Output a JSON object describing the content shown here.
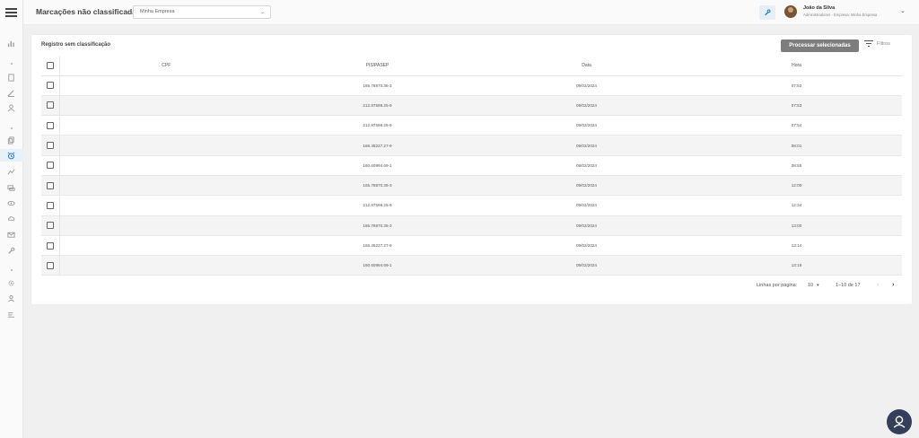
{
  "header": {
    "page_title": "Marcações não classificadas",
    "company_select": {
      "value": "Minha Empresa"
    },
    "user": {
      "name": "João da Silva",
      "role": "Administradores - Empresa: Minha Empresa"
    }
  },
  "sidebar": {
    "items": [
      {
        "icon": "menu-icon"
      },
      {
        "icon": "chart-icon"
      },
      {
        "icon": "document-icon"
      },
      {
        "icon": "pen-icon"
      },
      {
        "icon": "user-icon"
      },
      {
        "icon": "copy-icon"
      },
      {
        "icon": "alarm-clock-icon",
        "active": true
      },
      {
        "icon": "trend-icon"
      },
      {
        "icon": "chat-icon"
      },
      {
        "icon": "eye-icon"
      },
      {
        "icon": "cloud-icon"
      },
      {
        "icon": "mail-icon"
      },
      {
        "icon": "wrench-icon"
      },
      {
        "icon": "settings-icon"
      },
      {
        "icon": "person-icon"
      },
      {
        "icon": "list-icon"
      }
    ]
  },
  "card": {
    "title": "Registro sem classificação",
    "process_button": "Processar selecionadas",
    "filters_label": "Filtros"
  },
  "table": {
    "columns": {
      "cpf": "CPF",
      "pis": "PIS/PASEP",
      "data": "Data",
      "hora": "Hora"
    },
    "rows": [
      {
        "cpf": "",
        "pis": "165.78870.36-3",
        "data": "09/02/2024",
        "hora": "07:53"
      },
      {
        "cpf": "",
        "pis": "212.87599.25-9",
        "data": "09/02/2024",
        "hora": "07:53"
      },
      {
        "cpf": "",
        "pis": "212.87599.25-9",
        "data": "09/02/2024",
        "hora": "07:54"
      },
      {
        "cpf": "",
        "pis": "166.45227.27-9",
        "data": "09/02/2024",
        "hora": "08:01"
      },
      {
        "cpf": "",
        "pis": "160.60994.69-1",
        "data": "09/02/2024",
        "hora": "08:55"
      },
      {
        "cpf": "",
        "pis": "165.78870.36-3",
        "data": "09/02/2024",
        "hora": "12:00"
      },
      {
        "cpf": "",
        "pis": "212.87599.25-9",
        "data": "09/02/2024",
        "hora": "12:34"
      },
      {
        "cpf": "",
        "pis": "165.78870.36-3",
        "data": "09/02/2024",
        "hora": "13:00"
      },
      {
        "cpf": "",
        "pis": "166.45227.27-9",
        "data": "09/02/2024",
        "hora": "13:14"
      },
      {
        "cpf": "",
        "pis": "160.60994.69-1",
        "data": "09/02/2024",
        "hora": "13:19"
      }
    ]
  },
  "pagination": {
    "rows_per_page_label": "Linhas por página:",
    "rows_per_page": "10",
    "range": "1–10 de 17"
  },
  "colors": {
    "accent": "#1976d2",
    "button": "#7d7d7d",
    "fab": "#34405a"
  }
}
